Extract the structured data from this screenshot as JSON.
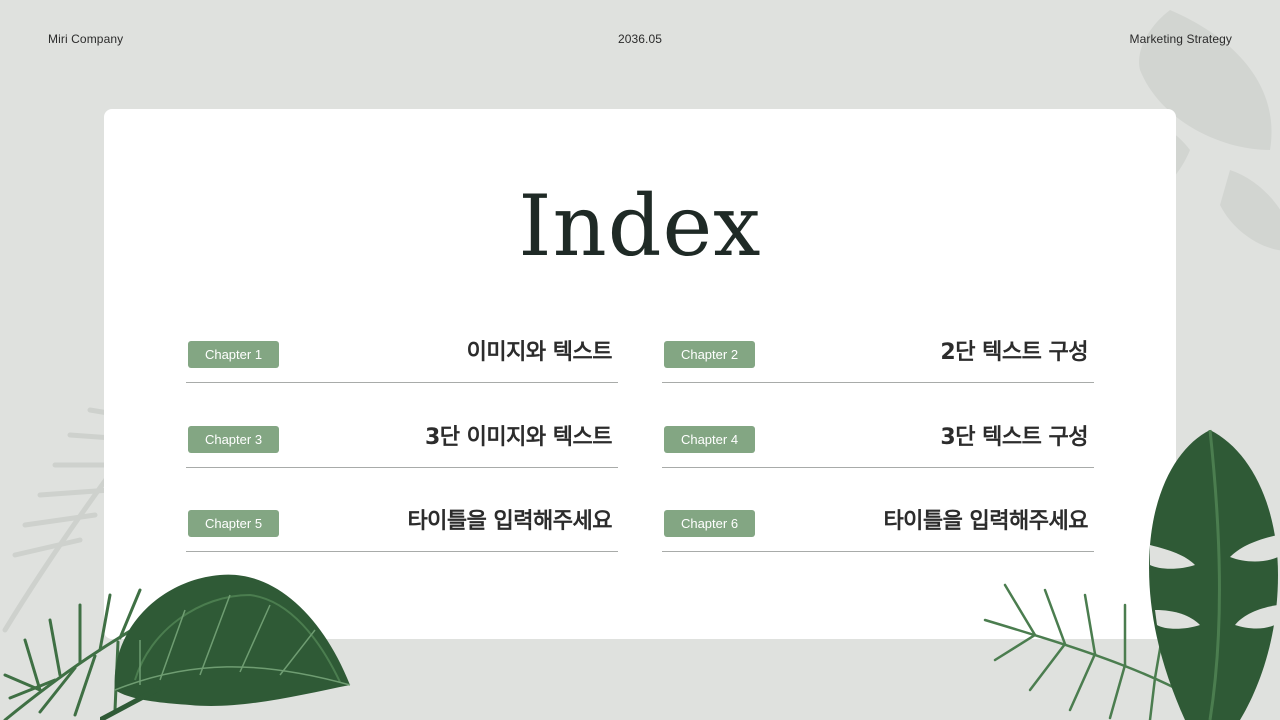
{
  "header": {
    "company": "Miri Company",
    "date": "2036.05",
    "subject": "Marketing Strategy"
  },
  "page_title": "Index",
  "chapters": [
    {
      "badge": "Chapter 1",
      "title": "이미지와 텍스트"
    },
    {
      "badge": "Chapter 2",
      "title": "2단 텍스트 구성"
    },
    {
      "badge": "Chapter 3",
      "title": "3단 이미지와 텍스트"
    },
    {
      "badge": "Chapter 4",
      "title": "3단 텍스트 구성"
    },
    {
      "badge": "Chapter 5",
      "title": "타이틀을 입력해주세요"
    },
    {
      "badge": "Chapter 6",
      "title": "타이틀을 입력해주세요"
    }
  ],
  "colors": {
    "background": "#dfe1de",
    "card": "#ffffff",
    "badge": "#83a683",
    "leaf_dark": "#2f5a36",
    "leaf_mid": "#4b7d4f"
  }
}
